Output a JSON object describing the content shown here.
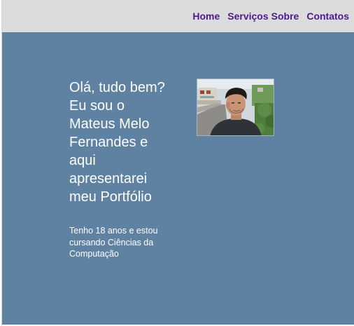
{
  "nav": {
    "home": "Home",
    "servicos": "Serviços",
    "sobre": "Sobre",
    "contatos": "Contatos"
  },
  "hero": {
    "headline": "Olá, tudo bem? Eu sou o Mateus Melo Fernandes e aqui apresentarei meu Portfólio",
    "subtitle": "Tenho 18 anos e estou cursando Ciências da Computação"
  },
  "colors": {
    "header_bg": "#dcdcdc",
    "nav_text": "#4b1a8c",
    "hero_bg": "#5f82a3",
    "hero_text": "#ffffff"
  }
}
